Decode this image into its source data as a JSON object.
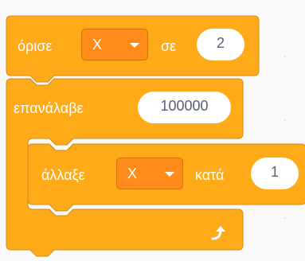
{
  "colors": {
    "block_fill": "#ffab19",
    "block_stroke": "#cf8b17",
    "dropdown_fill": "#ff8c1a",
    "input_text": "#575e75"
  },
  "set_block": {
    "label": "όρισε",
    "variable": "X",
    "preposition": "σε",
    "value": "2"
  },
  "repeat_block": {
    "label": "επανάλαβε",
    "times": "100000",
    "end_icon": "loop-arrow-icon"
  },
  "change_block": {
    "label": "άλλαξε",
    "variable": "X",
    "preposition": "κατά",
    "value": "1"
  }
}
